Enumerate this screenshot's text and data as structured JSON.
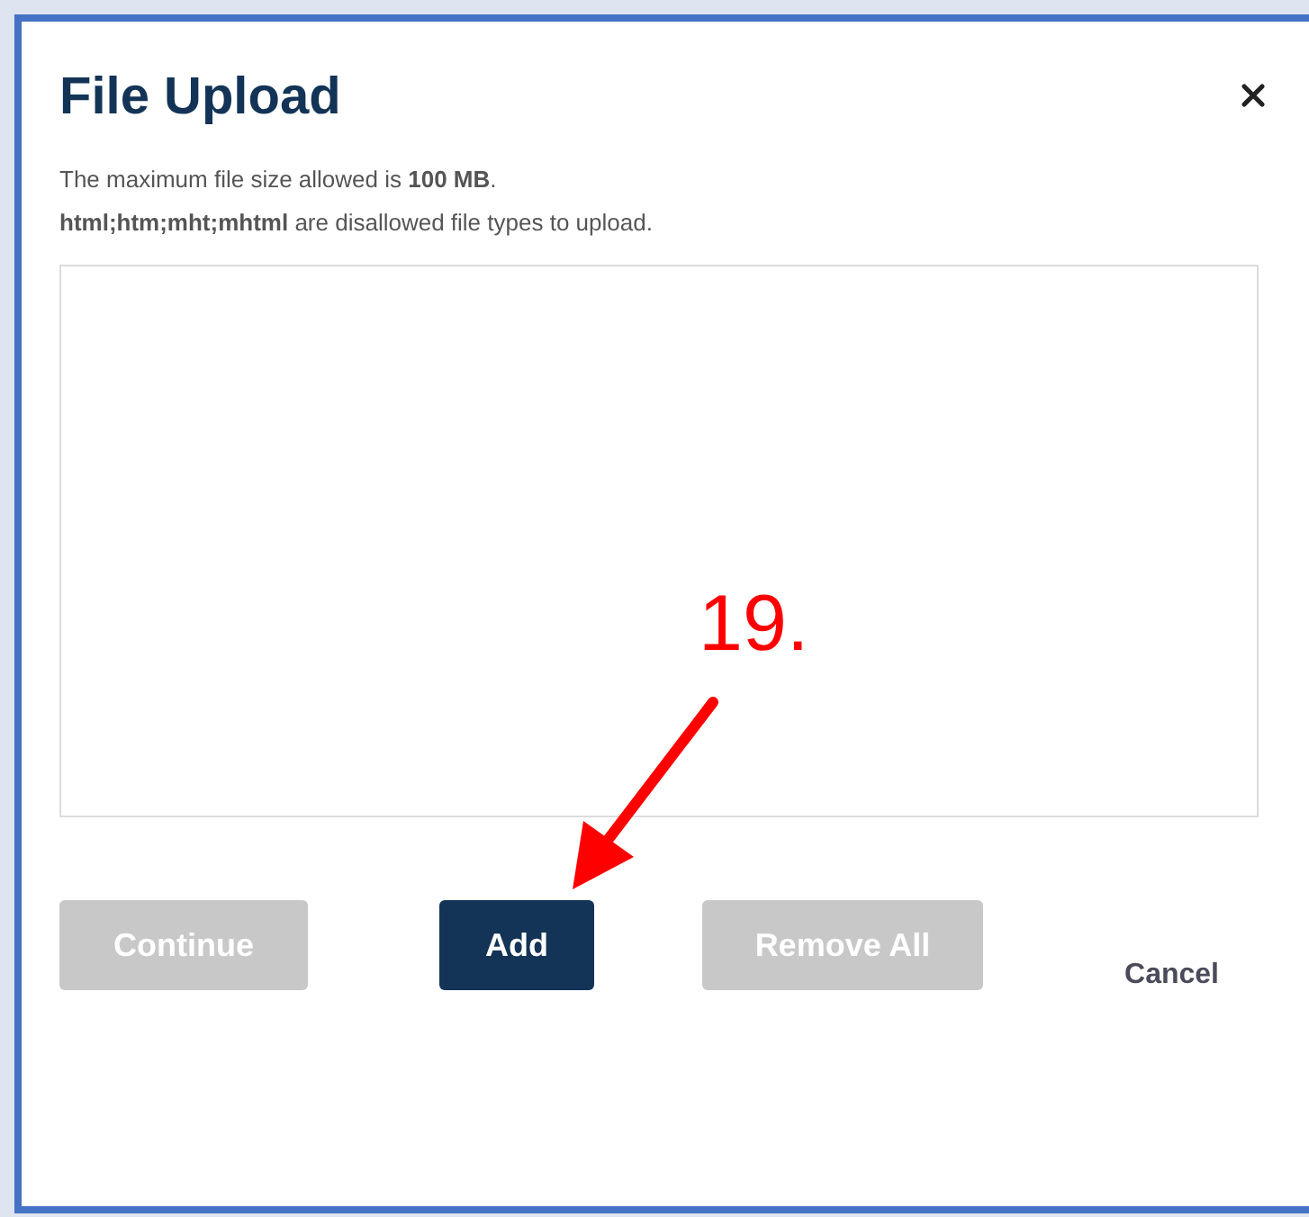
{
  "dialog": {
    "title": "File Upload",
    "notes": [
      "The maximum file size allowed is **100 MB**.",
      "**html;htm;mht;mhtml** are disallowed file types to upload."
    ],
    "buttons": [
      {
        "kind": "secondary",
        "label": "Continue",
        "disabled": true
      },
      {
        "kind": "primary",
        "label": "Add",
        "disabled": false
      },
      {
        "kind": "secondary",
        "label": "Remove All",
        "disabled": true
      },
      {
        "kind": "link",
        "label": "Cancel",
        "disabled": false
      }
    ]
  },
  "annotation": {
    "label": "19."
  }
}
